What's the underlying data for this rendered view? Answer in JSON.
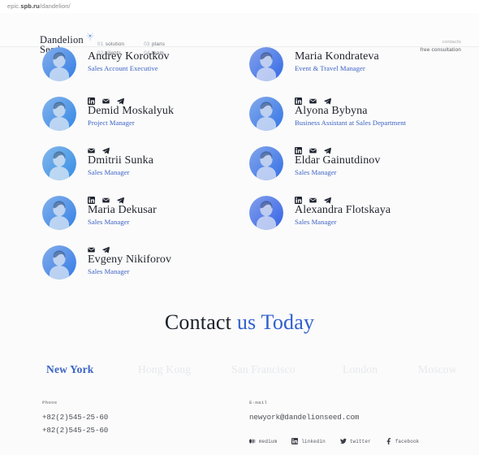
{
  "browser": {
    "url_prefix": "epic.",
    "url_bold": "spb.ru",
    "url_suffix": "/dandelion/"
  },
  "header": {
    "logo_line1": "Dandelion",
    "logo_line2": "Seed",
    "logo_icon": "dandelion-seed-icon",
    "nav": [
      {
        "num": "01",
        "label": "solution"
      },
      {
        "num": "02",
        "label": "clients"
      },
      {
        "num": "03",
        "label": "plans"
      },
      {
        "num": "04",
        "label": "team"
      }
    ],
    "contacts_label": "contacts",
    "free_consultation_label": "free consultation"
  },
  "team": {
    "members": [
      {
        "name": "Andrey Korotkov",
        "role": "Sales Account Executive",
        "socials": [],
        "col": 0,
        "row": 0,
        "avatar_hue": 215
      },
      {
        "name": "Maria Kondrateva",
        "role": "Event & Travel Manager",
        "socials": [],
        "col": 1,
        "row": 0,
        "avatar_hue": 222
      },
      {
        "name": "Demid Moskalyuk",
        "role": "Project Manager",
        "socials": [
          "linkedin-icon",
          "mail-icon",
          "telegram-icon"
        ],
        "col": 0,
        "row": 1,
        "avatar_hue": 212
      },
      {
        "name": "Alyona Bybyna",
        "role": "Business Assistant at Sales Department",
        "socials": [
          "linkedin-icon",
          "mail-icon",
          "telegram-icon"
        ],
        "col": 1,
        "row": 1,
        "avatar_hue": 218
      },
      {
        "name": "Dmitrii Sunka",
        "role": "Sales Manager",
        "socials": [
          "mail-icon",
          "telegram-icon"
        ],
        "col": 0,
        "row": 2,
        "avatar_hue": 210
      },
      {
        "name": "Eldar Gainutdinov",
        "role": "Sales Manager",
        "socials": [
          "linkedin-icon",
          "mail-icon",
          "telegram-icon"
        ],
        "col": 1,
        "row": 2,
        "avatar_hue": 220
      },
      {
        "name": "Maria Dekusar",
        "role": "Sales Manager",
        "socials": [
          "linkedin-icon",
          "mail-icon",
          "telegram-icon"
        ],
        "col": 0,
        "row": 3,
        "avatar_hue": 214
      },
      {
        "name": "Alexandra Flotskaya",
        "role": "Sales Manager",
        "socials": [
          "linkedin-icon",
          "mail-icon",
          "telegram-icon"
        ],
        "col": 1,
        "row": 3,
        "avatar_hue": 224
      },
      {
        "name": "Evgeny Nikiforov",
        "role": "Sales Manager",
        "socials": [
          "mail-icon",
          "telegram-icon"
        ],
        "col": 0,
        "row": 4,
        "avatar_hue": 216
      }
    ]
  },
  "contact": {
    "heading_dark": "Contact ",
    "heading_blue": "us Today",
    "cities": [
      {
        "label": "New York",
        "active": true
      },
      {
        "label": "Hong Kong",
        "active": false
      },
      {
        "label": "San Francisco",
        "active": false
      },
      {
        "label": "London",
        "active": false
      },
      {
        "label": "Moscow",
        "active": false
      }
    ],
    "phone_label": "Phone",
    "phones": [
      "+82(2)545-25-60",
      "+82(2)545-25-60"
    ],
    "email_label": "E-mail",
    "email": "newyork@dandelionseed.com"
  },
  "footer": {
    "socials": [
      {
        "label": "medium",
        "icon": "medium-icon"
      },
      {
        "label": "linkedin",
        "icon": "linkedin-icon"
      },
      {
        "label": "twitter",
        "icon": "twitter-icon"
      },
      {
        "label": "facebook",
        "icon": "facebook-icon"
      }
    ]
  },
  "colors": {
    "accent": "#3a63c7",
    "role_blue": "#3b62c4",
    "heading_dark": "#1d212b",
    "muted": "#e6e8ec"
  }
}
